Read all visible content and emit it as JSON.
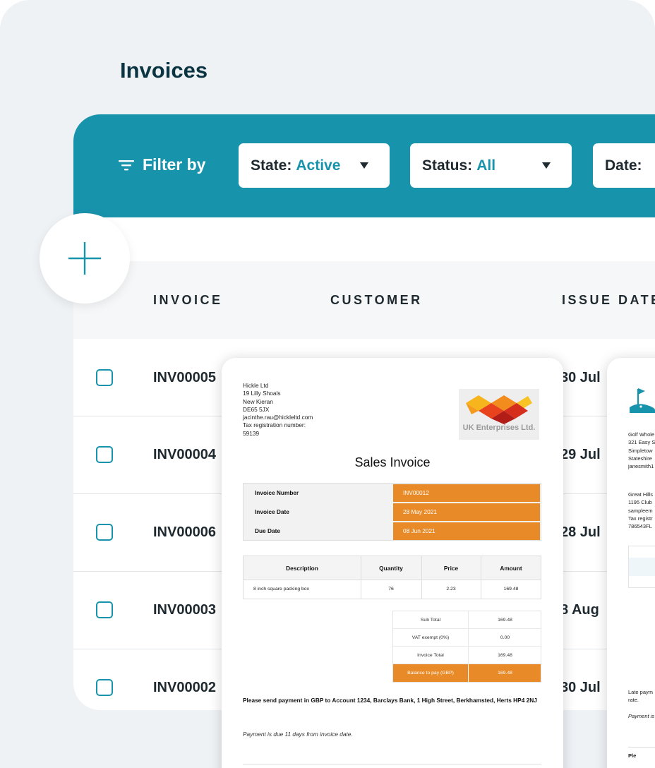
{
  "page": {
    "title": "Invoices"
  },
  "filter_bar": {
    "label": "Filter by",
    "state": {
      "label": "State:",
      "value": "Active"
    },
    "status": {
      "label": "Status:",
      "value": "All"
    },
    "date": {
      "label": "Date:"
    }
  },
  "table": {
    "columns": [
      "INVOICE",
      "CUSTOMER",
      "ISSUE DATE"
    ],
    "rows": [
      {
        "invoice": "INV00005",
        "issue_date": "30 Jul"
      },
      {
        "invoice": "INV00004",
        "issue_date": "29 Jul"
      },
      {
        "invoice": "INV00006",
        "issue_date": "28 Jul"
      },
      {
        "invoice": "INV00003",
        "issue_date": "8 Aug"
      },
      {
        "invoice": "INV00002",
        "issue_date": "30 Jul"
      }
    ]
  },
  "colors": {
    "accent": "#1893ac",
    "heading": "#0a3441",
    "invoice_orange": "#e88a27"
  },
  "invoice_doc": {
    "from": [
      "Hickle Ltd",
      "19 Lilly Shoals",
      "New Kieran",
      "DE65 5JX",
      "jacinthe.rau@hickleltd.com",
      "Tax registration number:",
      "59139"
    ],
    "logo_text": "UK Enterprises Ltd.",
    "title": "Sales Invoice",
    "meta": [
      {
        "label": "Invoice Number",
        "value": "INV00012"
      },
      {
        "label": "Invoice Date",
        "value": "28 May 2021"
      },
      {
        "label": "Due Date",
        "value": "08 Jun 2021"
      }
    ],
    "items_header": [
      "Description",
      "Quantity",
      "Price",
      "Amount"
    ],
    "items": [
      {
        "description": "8 inch square packing box",
        "quantity": "76",
        "price": "2.23",
        "amount": "169.48"
      }
    ],
    "totals": [
      {
        "label": "Sub Total",
        "value": "169.48"
      },
      {
        "label": "VAT exempt (0%)",
        "value": "0.00"
      },
      {
        "label": "Invoice Total",
        "value": "169.48"
      },
      {
        "label": "Balance to pay (GBP)",
        "value": "169.48"
      }
    ],
    "payment_note": "Please send payment in GBP to Account 1234, Barclays Bank, 1 High Street, Berkhamsted, Herts HP4 2NJ",
    "due_note": "Payment is due 11 days from invoice date."
  },
  "second_doc": {
    "from": [
      "Golf Whole",
      "321 Easy S",
      "Simpletow",
      "Stateshire",
      "janesmith1"
    ],
    "to": [
      "Great Hills",
      "1195 Club",
      "sampleem",
      "Tax registr",
      "786543FL"
    ],
    "late_note": [
      "Late paym",
      "rate."
    ],
    "payment_note": "Payment is",
    "footer": "Ple"
  }
}
